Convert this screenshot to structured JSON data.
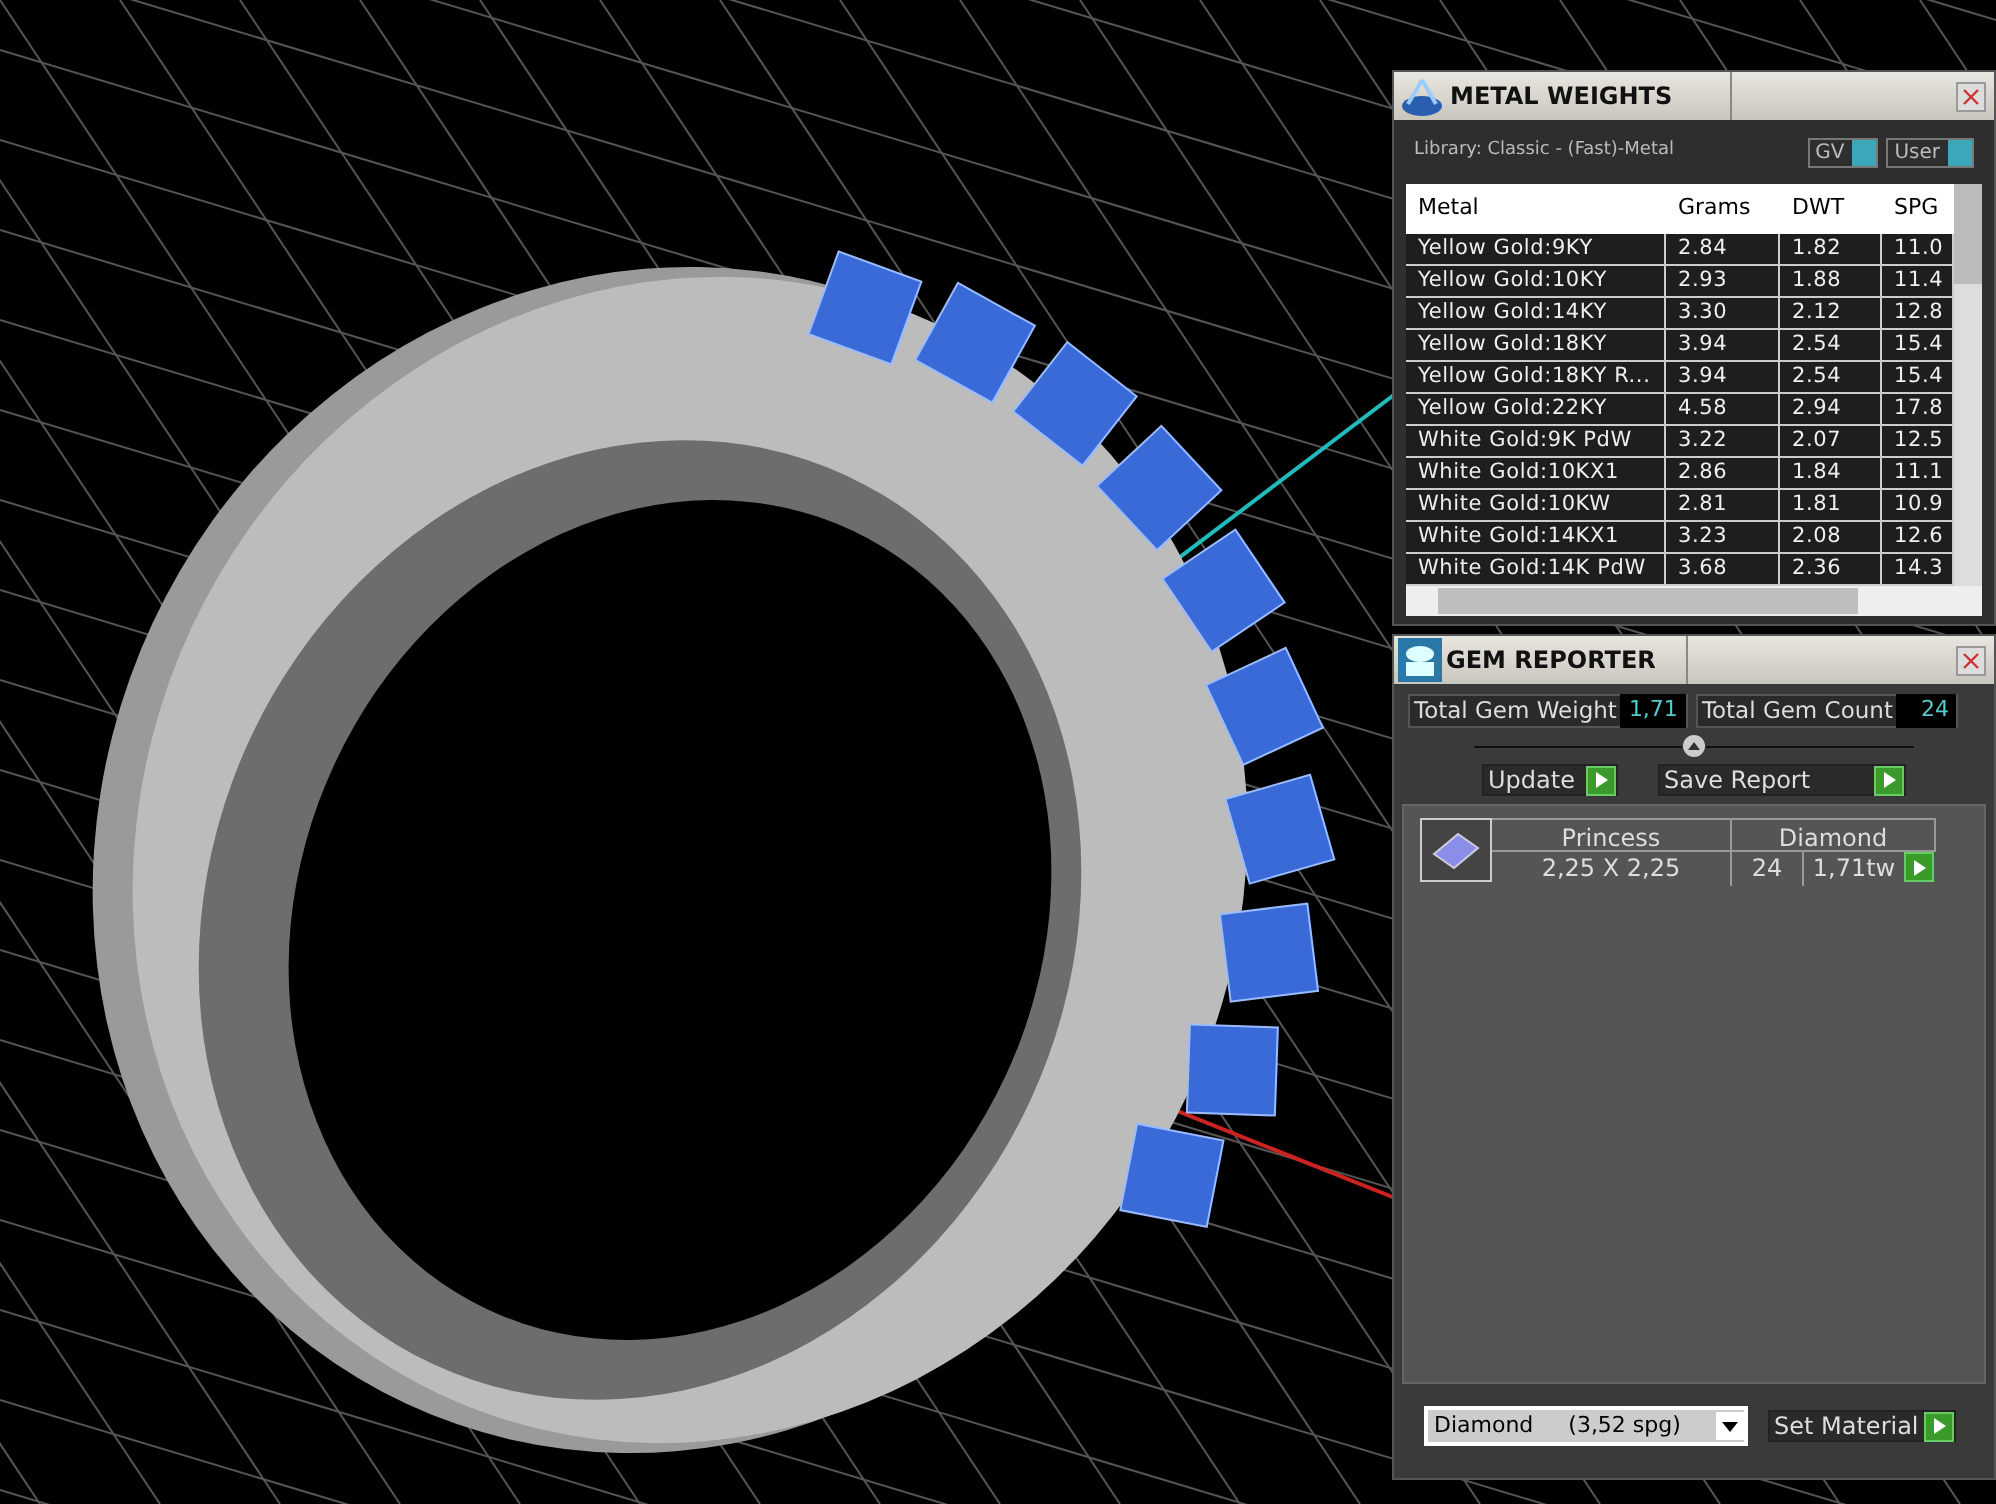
{
  "metal_weights": {
    "title": "METAL WEIGHTS",
    "library": "Library: Classic - (Fast)-Metal",
    "toggles": [
      {
        "label": "GV",
        "on": true
      },
      {
        "label": "User",
        "on": true
      }
    ],
    "table": {
      "columns": [
        "Metal",
        "Grams",
        "DWT",
        "SPG"
      ],
      "rows": [
        [
          "Yellow Gold:9KY",
          "2.84",
          "1.82",
          "11.0"
        ],
        [
          "Yellow Gold:10KY",
          "2.93",
          "1.88",
          "11.4"
        ],
        [
          "Yellow Gold:14KY",
          "3.30",
          "2.12",
          "12.8"
        ],
        [
          "Yellow Gold:18KY",
          "3.94",
          "2.54",
          "15.4"
        ],
        [
          "Yellow Gold:18KY R...",
          "3.94",
          "2.54",
          "15.4"
        ],
        [
          "Yellow Gold:22KY",
          "4.58",
          "2.94",
          "17.8"
        ],
        [
          "White Gold:9K PdW",
          "3.22",
          "2.07",
          "12.5"
        ],
        [
          "White Gold:10KX1",
          "2.86",
          "1.84",
          "11.1"
        ],
        [
          "White Gold:10KW",
          "2.81",
          "1.81",
          "10.9"
        ],
        [
          "White Gold:14KX1",
          "3.23",
          "2.08",
          "12.6"
        ],
        [
          "White Gold:14K PdW",
          "3.68",
          "2.36",
          "14.3"
        ]
      ]
    }
  },
  "gem_reporter": {
    "title": "GEM REPORTER",
    "total_weight": {
      "label": "Total Gem Weight",
      "value": "1,71"
    },
    "total_count": {
      "label": "Total Gem Count",
      "value": "24"
    },
    "buttons": [
      "Update",
      "Save Report"
    ],
    "gems": [
      {
        "shape": "Princess",
        "material": "Diamond",
        "size": "2,25 X 2,25",
        "count": "24",
        "weight": "1,71tw"
      }
    ],
    "material_select": "Diamond     (3,52 spg)",
    "set_button": "Set Material"
  }
}
